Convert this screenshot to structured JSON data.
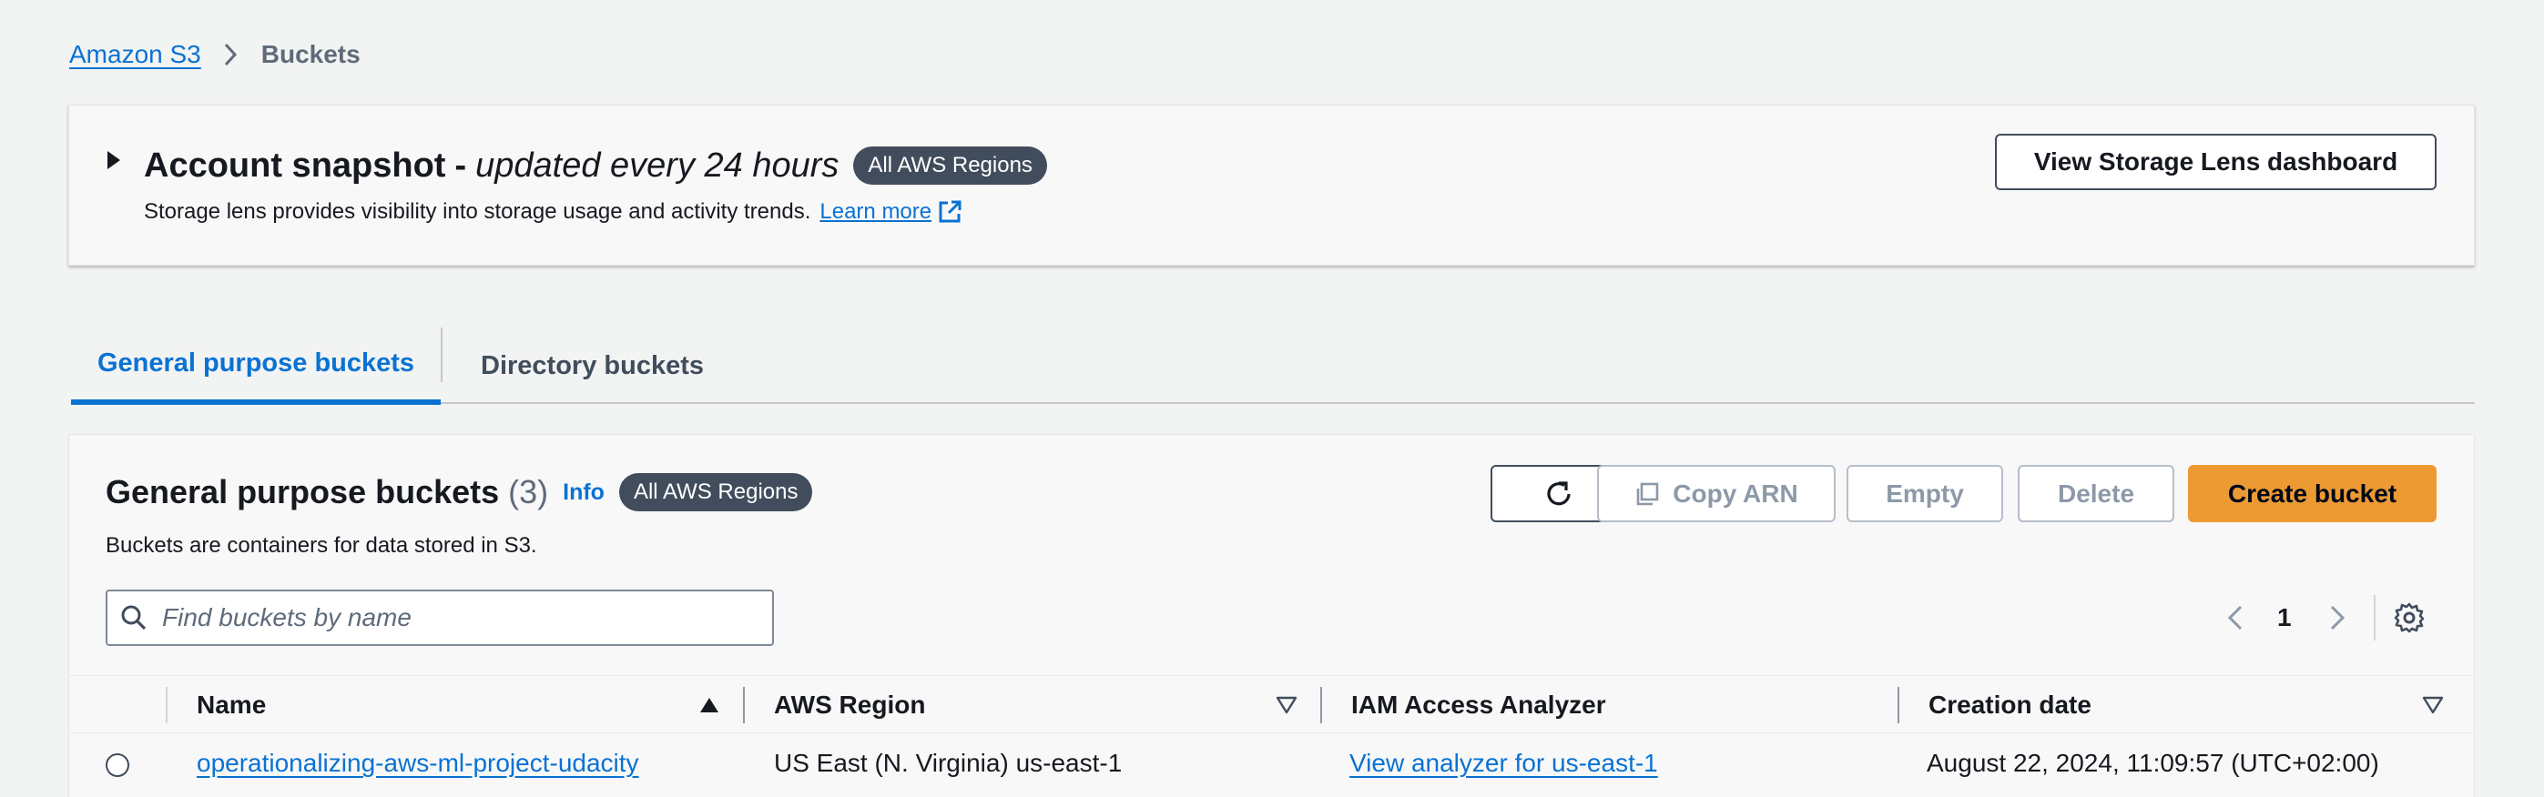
{
  "breadcrumb": {
    "root": "Amazon S3",
    "current": "Buckets"
  },
  "snapshot": {
    "title_bold": "Account snapshot",
    "title_dash": "-",
    "title_italic": "updated every 24 hours",
    "regions_badge": "All AWS Regions",
    "description": "Storage lens provides visibility into storage usage and activity trends.",
    "learn_more": "Learn more",
    "lens_button": "View Storage Lens dashboard"
  },
  "tabs": [
    {
      "label": "General purpose buckets",
      "active": true
    },
    {
      "label": "Directory buckets",
      "active": false
    }
  ],
  "buckets_panel": {
    "heading": "General purpose buckets",
    "count": "(3)",
    "info": "Info",
    "regions_badge": "All AWS Regions",
    "description": "Buckets are containers for data stored in S3.",
    "toolbar": {
      "copy_arn": "Copy ARN",
      "empty": "Empty",
      "delete": "Delete",
      "create": "Create bucket"
    },
    "search_placeholder": "Find buckets by name",
    "page": "1",
    "columns": [
      "Name",
      "AWS Region",
      "IAM Access Analyzer",
      "Creation date"
    ],
    "rows": [
      {
        "name": "operationalizing-aws-ml-project-udacity",
        "region": "US East (N. Virginia) us-east-1",
        "analyzer": "View analyzer for us-east-1",
        "created": "August 22, 2024, 11:09:57 (UTC+02:00)"
      }
    ]
  },
  "colors": {
    "link": "#0972d3",
    "primary_button": "#ec9a34",
    "badge": "#414d5c",
    "background": "#f2f3f3"
  }
}
